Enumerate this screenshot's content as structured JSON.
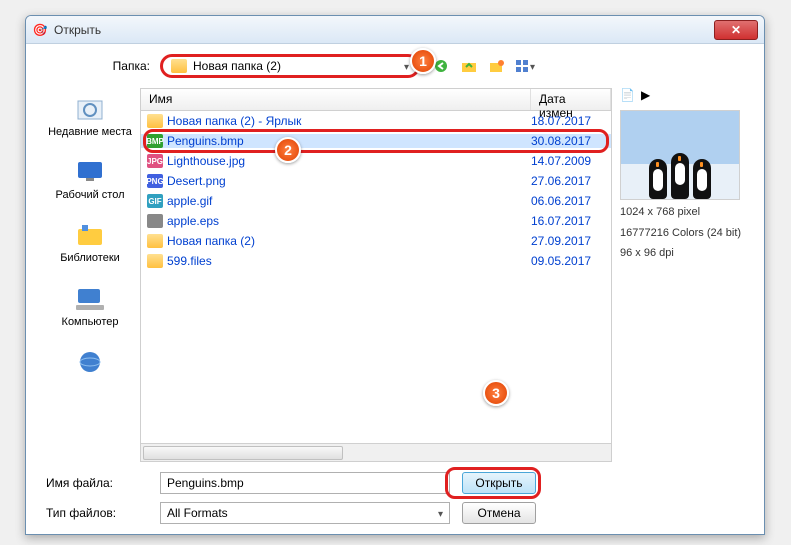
{
  "window": {
    "title": "Открыть",
    "close": "✕"
  },
  "folder": {
    "label": "Папка:",
    "current": "Новая папка (2)"
  },
  "toolbar_icons": {
    "back": "back-icon",
    "up": "up-icon",
    "newfolder": "new-folder-icon",
    "view": "view-mode-icon"
  },
  "places": [
    {
      "label": "Недавние места"
    },
    {
      "label": "Рабочий стол"
    },
    {
      "label": "Библиотеки"
    },
    {
      "label": "Компьютер"
    }
  ],
  "columns": {
    "name": "Имя",
    "date": "Дата измен"
  },
  "files": [
    {
      "name": "Новая папка (2) - Ярлык",
      "date": "18.07.2017",
      "type": "fold",
      "badge": ""
    },
    {
      "name": "Penguins.bmp",
      "date": "30.08.2017",
      "type": "bmp",
      "badge": "BMP",
      "selected": true
    },
    {
      "name": "Lighthouse.jpg",
      "date": "14.07.2009",
      "type": "jpg",
      "badge": "JPG"
    },
    {
      "name": "Desert.png",
      "date": "27.06.2017",
      "type": "png",
      "badge": "PNG"
    },
    {
      "name": "apple.gif",
      "date": "06.06.2017",
      "type": "gif",
      "badge": "GIF"
    },
    {
      "name": "apple.eps",
      "date": "16.07.2017",
      "type": "eps",
      "badge": ""
    },
    {
      "name": "Новая папка (2)",
      "date": "27.09.2017",
      "type": "fold",
      "badge": ""
    },
    {
      "name": "599.files",
      "date": "09.05.2017",
      "type": "fold",
      "badge": ""
    }
  ],
  "preview": {
    "dimensions": "1024 x 768 pixel",
    "colors": "16777216 Colors (24 bit)",
    "dpi": "96 x 96 dpi"
  },
  "filename": {
    "label": "Имя файла:",
    "value": "Penguins.bmp"
  },
  "filetype": {
    "label": "Тип файлов:",
    "value": "All Formats"
  },
  "buttons": {
    "open": "Открыть",
    "cancel": "Отмена"
  },
  "callouts": {
    "1": "1",
    "2": "2",
    "3": "3"
  }
}
